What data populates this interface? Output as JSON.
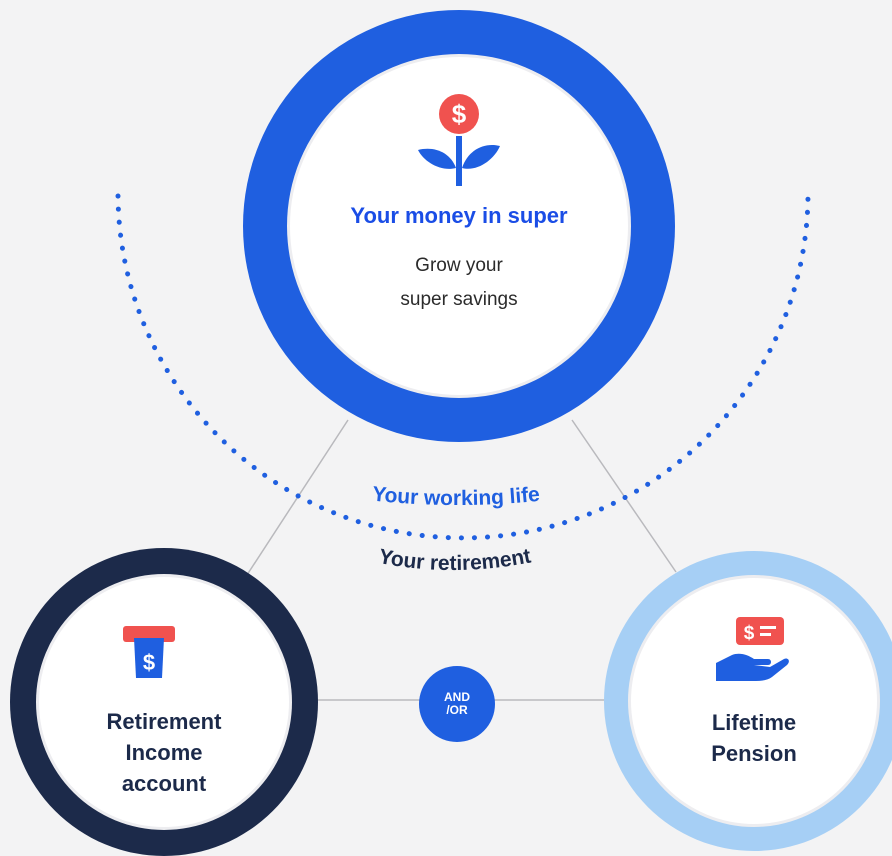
{
  "top_node": {
    "title": "Your money in super",
    "subtitle_line1": "Grow your",
    "subtitle_line2": "super savings",
    "icon": "money-plant-icon"
  },
  "phase_labels": {
    "working_life": "Your working life",
    "retirement": "Your retirement"
  },
  "left_node": {
    "title_line1": "Retirement",
    "title_line2": "Income",
    "title_line3": "account",
    "icon": "atm-withdrawal-icon"
  },
  "right_node": {
    "title_line1": "Lifetime",
    "title_line2": "Pension",
    "icon": "hand-holding-cash-icon"
  },
  "connector": {
    "line1": "AND",
    "line2": "/OR"
  },
  "colors": {
    "background": "#f3f3f4",
    "blue": "#1f5fe0",
    "navy": "#1c2a4a",
    "light_blue": "#a6cff5",
    "red": "#f0524f"
  }
}
